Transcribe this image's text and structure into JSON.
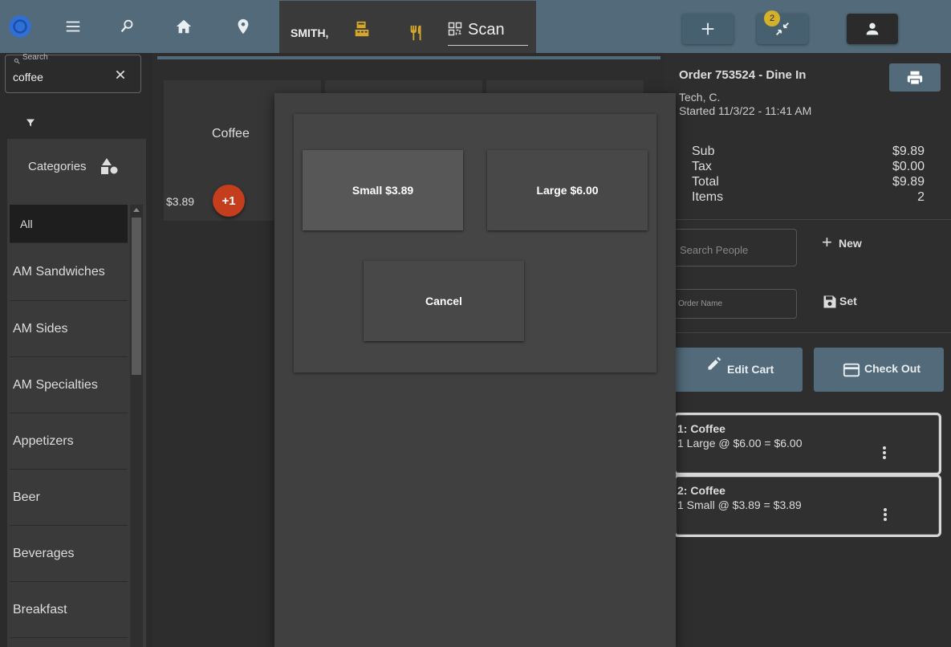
{
  "topbar": {
    "user": "SMITH,",
    "scan_label": "Scan",
    "badge_count": "2",
    "icons": [
      "logo-icon",
      "menu-icon",
      "search-person-icon",
      "home-icon",
      "location-icon",
      "register-icon",
      "utensils-icon",
      "qr-icon",
      "plus-icon",
      "collapse-icon",
      "person-icon"
    ]
  },
  "search": {
    "label": "Search",
    "value": "coffee"
  },
  "categories": {
    "title": "Categories",
    "items": [
      "All",
      "AM Sandwiches",
      "AM Sides",
      "AM Specialties",
      "Appetizers",
      "Beer",
      "Beverages",
      "Breakfast"
    ]
  },
  "product": {
    "name": "Coffee",
    "price": "$3.89",
    "add_label": "+1"
  },
  "modal": {
    "option1": "Small $3.89",
    "option2": "Large $6.00",
    "cancel": "Cancel"
  },
  "order": {
    "title": "Order 753524 - Dine In",
    "tech": "Tech, C.",
    "started": "Started 11/3/22 - 11:41 AM",
    "totals": [
      {
        "label": "Sub",
        "value": "$9.89"
      },
      {
        "label": "Tax",
        "value": "$0.00"
      },
      {
        "label": "Total",
        "value": "$9.89"
      },
      {
        "label": "Items",
        "value": "2"
      }
    ],
    "search_people_placeholder": "Search People",
    "new_label": "New",
    "order_name_placeholder": "Order Name",
    "set_label": "Set",
    "edit_cart": "Edit Cart",
    "check_out": "Check Out",
    "items": [
      {
        "title": "1: Coffee",
        "detail": "1 Large @ $6.00 = $6.00"
      },
      {
        "title": "2: Coffee",
        "detail": "1 Small @ $3.89 = $3.89"
      }
    ]
  },
  "colors": {
    "topbar": "#526a79",
    "accent_red": "#c43d1c",
    "gold": "#d4a62a",
    "badge": "#d4b12a"
  }
}
